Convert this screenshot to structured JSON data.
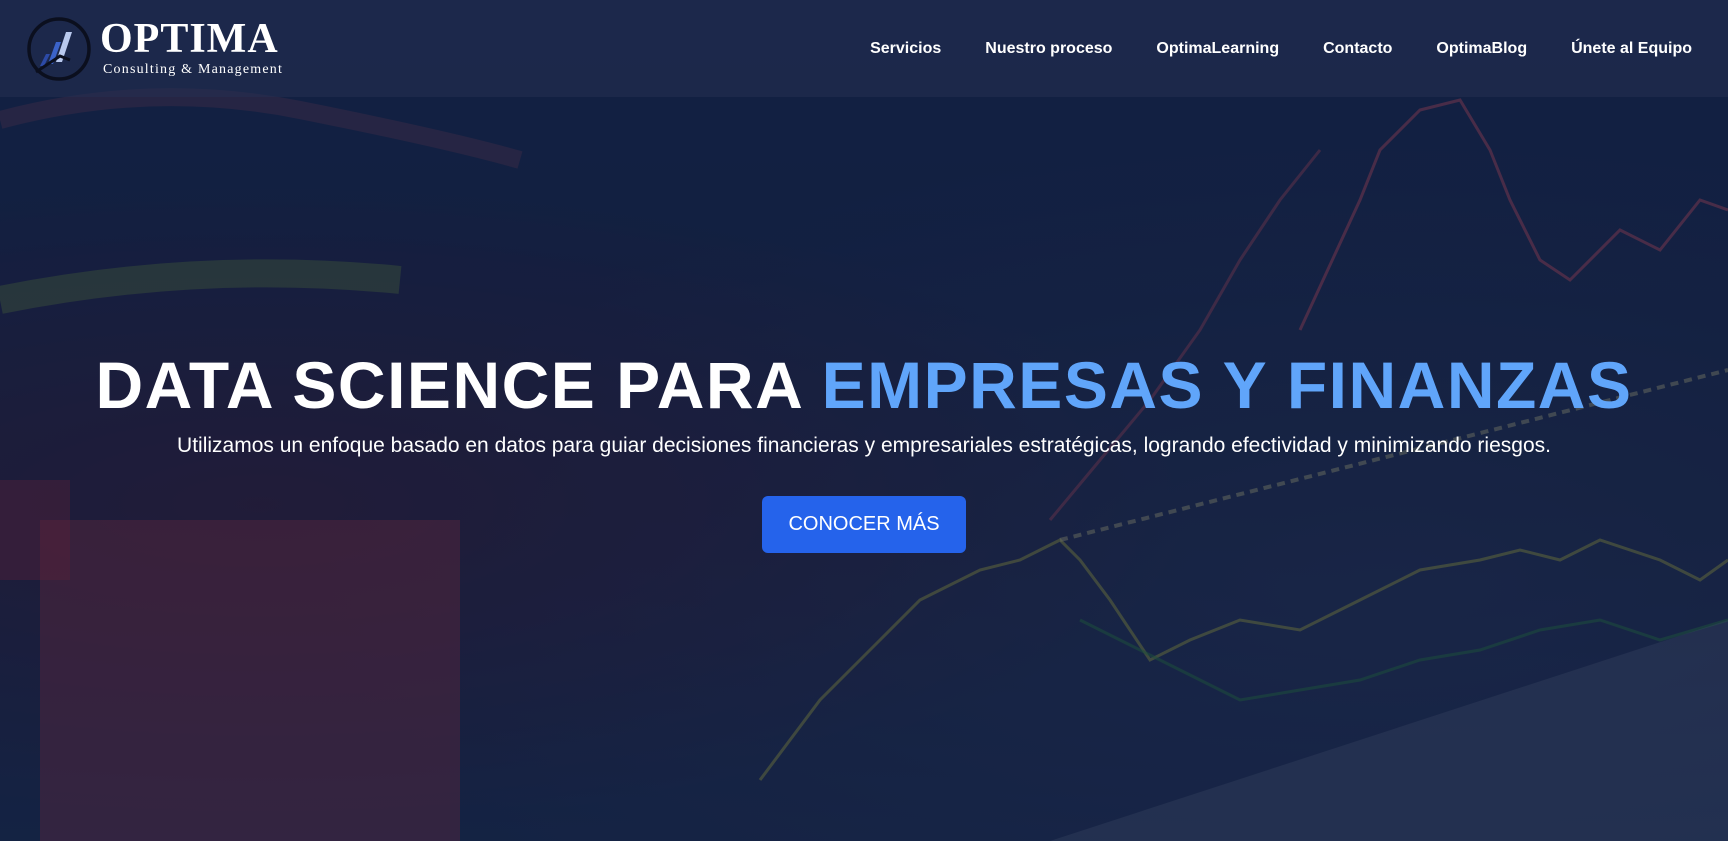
{
  "brand": {
    "name": "OPTIMA",
    "tagline": "Consulting & Management"
  },
  "nav": {
    "items": [
      {
        "label": "Servicios"
      },
      {
        "label": "Nuestro proceso"
      },
      {
        "label": "OptimaLearning"
      },
      {
        "label": "Contacto"
      },
      {
        "label": "OptimaBlog"
      },
      {
        "label": "Únete al Equipo"
      }
    ]
  },
  "hero": {
    "title_part1": "DATA SCIENCE PARA ",
    "title_part2": "EMPRESAS Y FINANZAS",
    "subtitle": "Utilizamos un enfoque basado en datos para guiar decisiones financieras y empresariales estratégicas, logrando efectividad y minimizando riesgos.",
    "cta_label": "CONOCER MÁS"
  },
  "colors": {
    "accent": "#60a5fa",
    "button": "#2563eb",
    "header_bg": "#243052",
    "background": "#13213f"
  },
  "icons": {
    "logo": "bar-chart-logo-icon"
  }
}
